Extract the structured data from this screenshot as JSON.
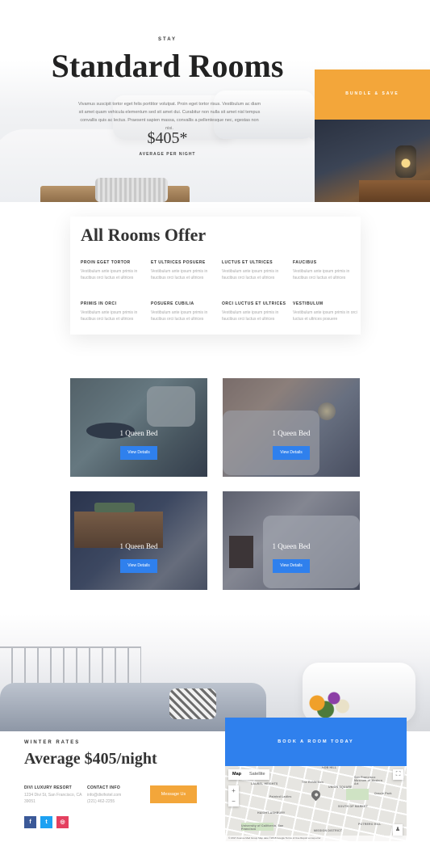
{
  "hero": {
    "eyebrow": "STAY",
    "title": "Standard Rooms",
    "description": "Vivamus suscipit tortor eget felis porttitor volutpat. Proin eget tortor risus. Vestibulum ac diam sit amet quam vehicula elementum sed sit amet dui. Curabitur non nulla sit amet nisl tempus convallis quis ac lectus. Praesent sapien massa, convallis a pellentesque nec, egestas non nisi.",
    "price": "$405*",
    "price_label": "AVERAGE PER NIGHT",
    "bundle_label": "BUNDLE & SAVE",
    "colors": {
      "accent": "#f3a63a"
    }
  },
  "features": {
    "title": "All Rooms Offer",
    "items": [
      {
        "title": "PROIN EGET TORTOR",
        "text": "Vestibulum ante ipsum primis in faucibus orci luctus et ultrices"
      },
      {
        "title": "ET ULTRICES POSUERE",
        "text": "Vestibulum ante ipsum primis in faucibus orci luctus et ultrices"
      },
      {
        "title": "LUCTUS ET ULTRICES",
        "text": "Vestibulum ante ipsum primis in faucibus orci luctus et ultrices"
      },
      {
        "title": "FAUCIBUS",
        "text": "Vestibulum ante ipsum primis in faucibus orci luctus et ultrices"
      },
      {
        "title": "PRIMIS IN ORCI",
        "text": "Vestibulum ante ipsum primis in faucibus orci luctus et ultrices"
      },
      {
        "title": "POSUERE CUBILIA",
        "text": "Vestibulum ante ipsum primis in faucibus orci luctus et ultrices"
      },
      {
        "title": "ORCI LUCTUS ET ULTRICES",
        "text": "Vestibulum ante ipsum primis in faucibus orci luctus et ultrices"
      },
      {
        "title": "VESTIBULUM",
        "text": "Vestibulum ante ipsum primis in orci luctus et ultrices posuere"
      }
    ]
  },
  "rooms": [
    {
      "name": "1 Queen Bed",
      "button": "View Details"
    },
    {
      "name": "1 Queen Bed",
      "button": "View Details"
    },
    {
      "name": "1 Queen Bed",
      "button": "View Details"
    },
    {
      "name": "1 Queen Bed",
      "button": "View Details"
    }
  ],
  "footer": {
    "eyebrow": "WINTER RATES",
    "headline": "Average $405/night",
    "resort": {
      "heading": "DIVI LUXURY RESORT",
      "lines": [
        "1234 Divi St, San Francisco, CA",
        "39051"
      ]
    },
    "contact": {
      "heading": "CONTACT INFO",
      "lines": [
        "info@divihotel.com",
        "(221) 462-2255"
      ]
    },
    "message_button": "Message Us",
    "social": {
      "facebook": "f",
      "twitter": "t",
      "instagram": "◎"
    },
    "book_label": "BOOK A ROOM TODAY",
    "colors": {
      "book": "#2f80ed"
    }
  },
  "map": {
    "tab_map": "Map",
    "tab_satellite": "Satellite",
    "labels": [
      "NOB HILL",
      "San Francisco Museum of Modern Art",
      "The Exhibition",
      "LAUREL HEIGHTS",
      "UNION SQUARE",
      "Oracle Park",
      "Painted Ladies",
      "SOUTH OF MARKET",
      "HAIGHT-ASHBURY",
      "MISSION DISTRICT",
      "University of California, San Francisco",
      "POTRERO HILL"
    ],
    "zoom_in": "+",
    "zoom_out": "−",
    "footer_text": "© 2017 Avenue Med Group   Map data ©2018 Google   Terms of Use   Report a map error"
  }
}
